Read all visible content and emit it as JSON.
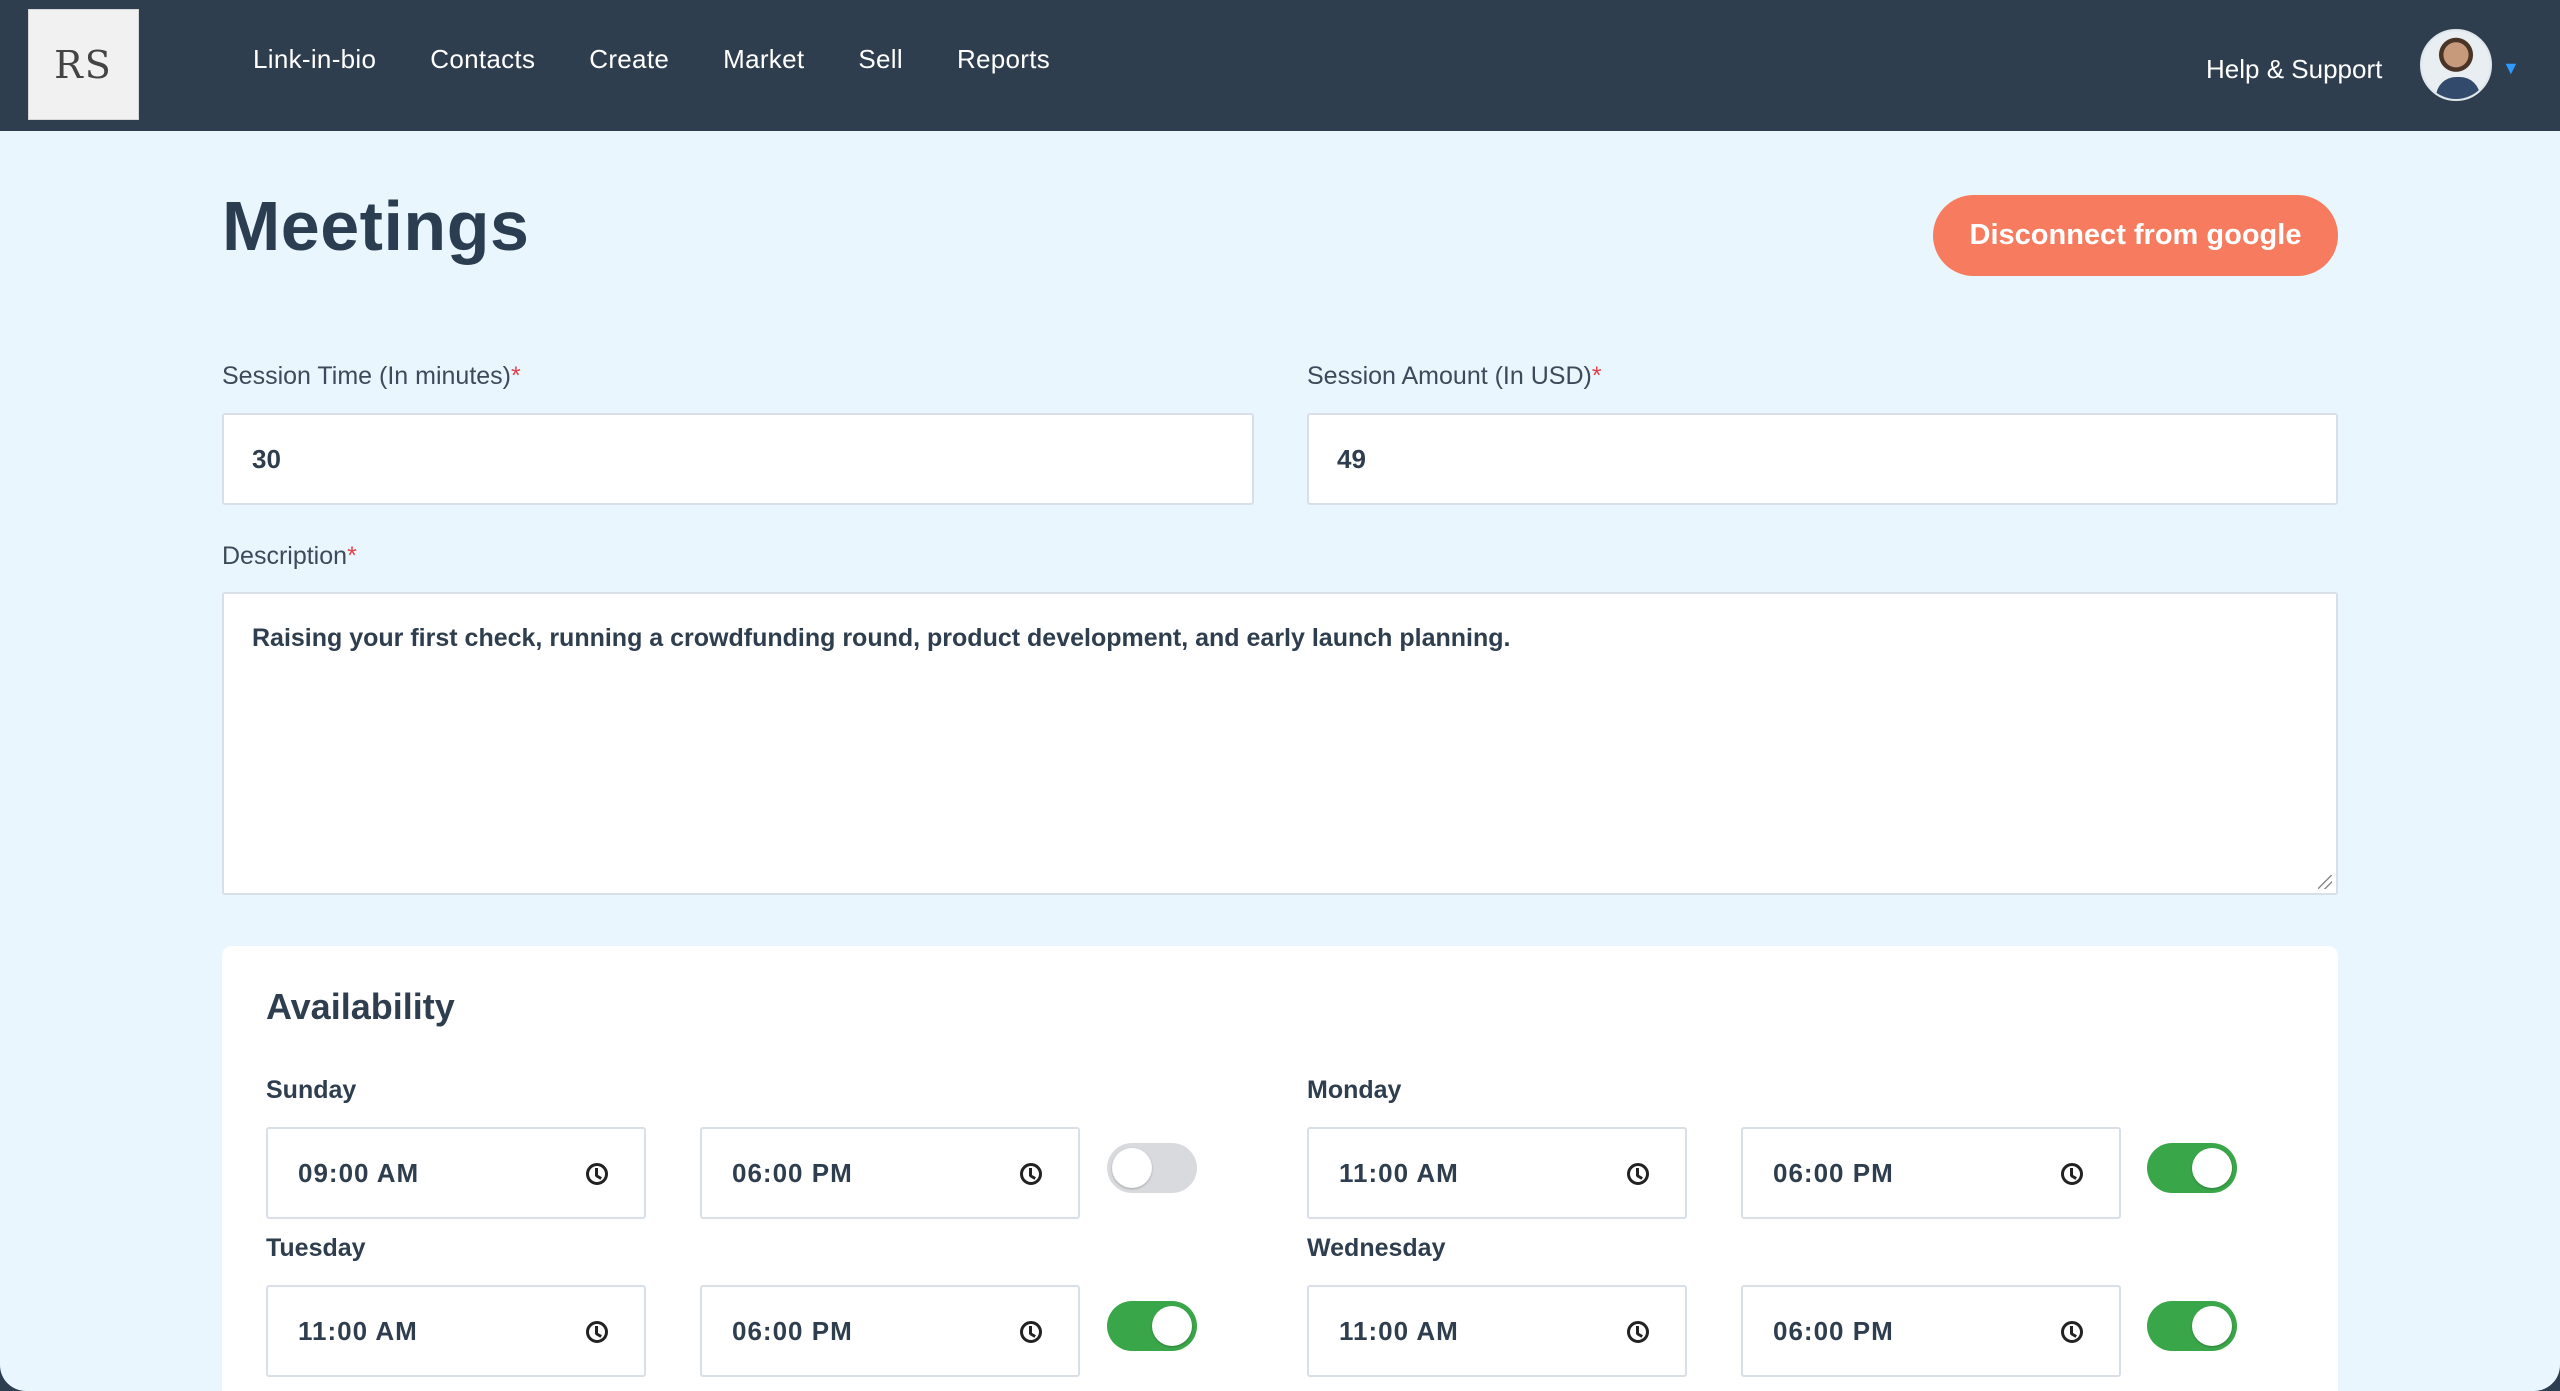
{
  "logo": {
    "text": "RS"
  },
  "nav": {
    "items": [
      "Link-in-bio",
      "Contacts",
      "Create",
      "Market",
      "Sell",
      "Reports"
    ],
    "help_label": "Help & Support"
  },
  "page": {
    "title": "Meetings",
    "disconnect_label": "Disconnect from google"
  },
  "form": {
    "session_time": {
      "label": "Session Time (In minutes)",
      "required_mark": "*",
      "value": "30"
    },
    "session_amount": {
      "label": "Session Amount (In USD)",
      "required_mark": "*",
      "value": "49"
    },
    "description": {
      "label": "Description",
      "required_mark": "*",
      "value": "Raising your first check, running a crowdfunding round, product development, and early launch planning."
    }
  },
  "availability": {
    "title": "Availability",
    "days": [
      {
        "name": "Sunday",
        "start": "09:00 AM",
        "end": "06:00 PM",
        "enabled": false
      },
      {
        "name": "Monday",
        "start": "11:00 AM",
        "end": "06:00 PM",
        "enabled": true
      },
      {
        "name": "Tuesday",
        "start": "11:00 AM",
        "end": "06:00 PM",
        "enabled": true
      },
      {
        "name": "Wednesday",
        "start": "11:00 AM",
        "end": "06:00 PM",
        "enabled": true
      }
    ]
  },
  "colors": {
    "topbar": "#2f3e4e",
    "page_background": "#eaf6fe",
    "accent_button": "#f77b5e",
    "toggle_on": "#3aa64a",
    "toggle_off": "#d8dadd",
    "required": "#e0424a"
  }
}
